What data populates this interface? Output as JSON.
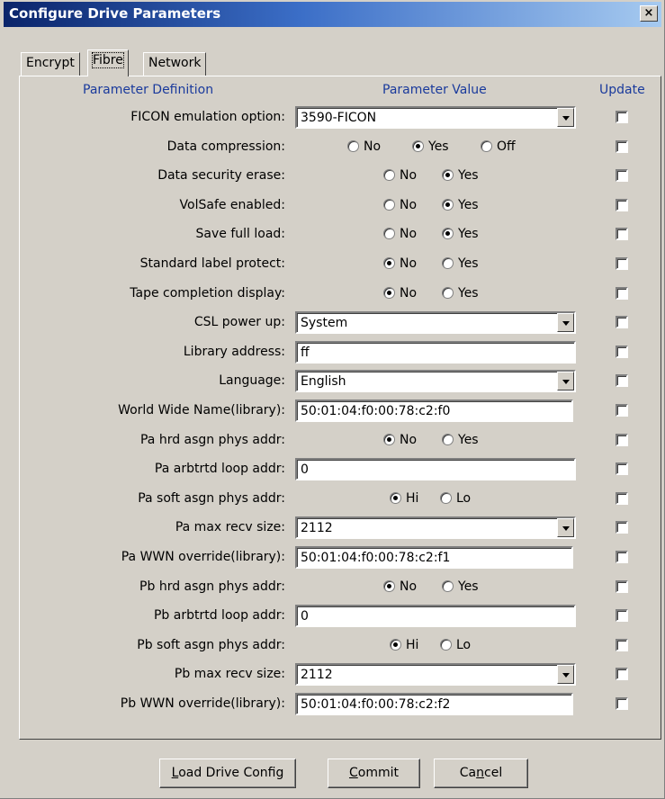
{
  "window": {
    "title": "Configure Drive Parameters",
    "close_glyph": "×"
  },
  "tabs": [
    {
      "label": "Encrypt",
      "active": false
    },
    {
      "label": "Fibre",
      "active": true
    },
    {
      "label": "Network",
      "active": false
    }
  ],
  "columns": {
    "definition": "Parameter Definition",
    "value": "Parameter Value",
    "update": "Update"
  },
  "rows": [
    {
      "label": "FICON emulation option:",
      "type": "dropdown",
      "value": "3590-FICON",
      "update": false
    },
    {
      "label": "Data compression:",
      "type": "radio",
      "options": [
        "No",
        "Yes",
        "Off"
      ],
      "selected": "Yes",
      "update": false
    },
    {
      "label": "Data security erase:",
      "type": "radio",
      "options": [
        "No",
        "Yes"
      ],
      "selected": "Yes",
      "update": false
    },
    {
      "label": "VolSafe enabled:",
      "type": "radio",
      "options": [
        "No",
        "Yes"
      ],
      "selected": "Yes",
      "update": false
    },
    {
      "label": "Save full load:",
      "type": "radio",
      "options": [
        "No",
        "Yes"
      ],
      "selected": "Yes",
      "update": false
    },
    {
      "label": "Standard label protect:",
      "type": "radio",
      "options": [
        "No",
        "Yes"
      ],
      "selected": "No",
      "update": false
    },
    {
      "label": "Tape completion display:",
      "type": "radio",
      "options": [
        "No",
        "Yes"
      ],
      "selected": "No",
      "update": false
    },
    {
      "label": "CSL power up:",
      "type": "dropdown",
      "value": "System",
      "update": false
    },
    {
      "label": "Library address:",
      "type": "text",
      "value": "ff",
      "update": false
    },
    {
      "label": "Language:",
      "type": "dropdown",
      "value": "English",
      "update": false
    },
    {
      "label": "World Wide Name(library):",
      "type": "text_short",
      "value": "50:01:04:f0:00:78:c2:f0",
      "update": false
    },
    {
      "label": "Pa hrd asgn phys addr:",
      "type": "radio",
      "options": [
        "No",
        "Yes"
      ],
      "selected": "No",
      "update": false
    },
    {
      "label": "Pa arbtrtd loop addr:",
      "type": "text",
      "value": "0",
      "update": false
    },
    {
      "label": "Pa soft asgn phys addr:",
      "type": "radio_hl",
      "options": [
        "Hi",
        "Lo"
      ],
      "selected": "Hi",
      "update": false
    },
    {
      "label": "Pa max recv size:",
      "type": "dropdown",
      "value": "2112",
      "update": false
    },
    {
      "label": "Pa WWN override(library):",
      "type": "text_short",
      "value": "50:01:04:f0:00:78:c2:f1",
      "update": false
    },
    {
      "label": "Pb hrd asgn phys addr:",
      "type": "radio",
      "options": [
        "No",
        "Yes"
      ],
      "selected": "No",
      "update": false
    },
    {
      "label": "Pb arbtrtd loop addr:",
      "type": "text",
      "value": "0",
      "update": false
    },
    {
      "label": "Pb soft asgn phys addr:",
      "type": "radio_hl",
      "options": [
        "Hi",
        "Lo"
      ],
      "selected": "Hi",
      "update": false
    },
    {
      "label": "Pb max recv size:",
      "type": "dropdown",
      "value": "2112",
      "update": false
    },
    {
      "label": "Pb WWN override(library):",
      "type": "text_short",
      "value": "50:01:04:f0:00:78:c2:f2",
      "update": false
    }
  ],
  "buttons": {
    "load": {
      "pre": "",
      "key": "L",
      "post": "oad Drive Config"
    },
    "commit": {
      "pre": "",
      "key": "C",
      "post": "ommit"
    },
    "cancel": {
      "pre": "Ca",
      "key": "n",
      "post": "cel"
    }
  }
}
